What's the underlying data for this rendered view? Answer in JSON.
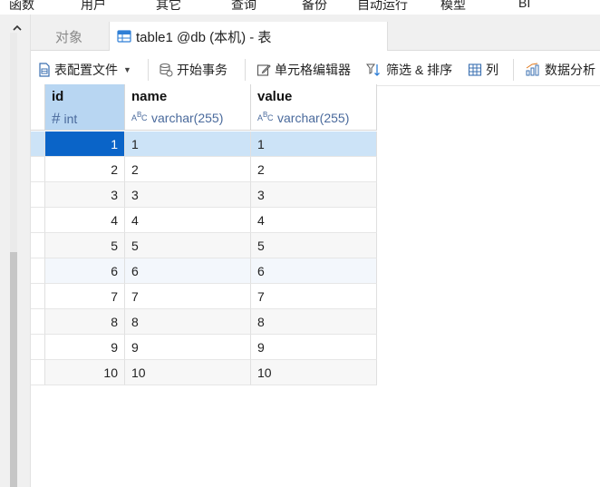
{
  "menubar": {
    "items": [
      "函数",
      "用户",
      "其它",
      "查询",
      "备份",
      "自动运行",
      "模型",
      "BI"
    ]
  },
  "tabs": {
    "objects_label": "对象",
    "table_label": "table1 @db (本机) - 表"
  },
  "toolbar": {
    "table_config_label": "表配置文件",
    "begin_transaction_label": "开始事务",
    "cell_editor_label": "单元格编辑器",
    "filter_sort_label": "筛选 & 排序",
    "columns_label": "列",
    "data_analysis_label": "数据分析"
  },
  "columns": [
    {
      "name": "id",
      "type": "int",
      "type_icon": "#"
    },
    {
      "name": "name",
      "type": "varchar(255)",
      "type_icon": "ABC"
    },
    {
      "name": "value",
      "type": "varchar(255)",
      "type_icon": "ABC"
    }
  ],
  "rows": [
    [
      "1",
      "1",
      "1"
    ],
    [
      "2",
      "2",
      "2"
    ],
    [
      "3",
      "3",
      "3"
    ],
    [
      "4",
      "4",
      "4"
    ],
    [
      "5",
      "5",
      "5"
    ],
    [
      "6",
      "6",
      "6"
    ],
    [
      "7",
      "7",
      "7"
    ],
    [
      "8",
      "8",
      "8"
    ],
    [
      "9",
      "9",
      "9"
    ],
    [
      "10",
      "10",
      "10"
    ]
  ],
  "colors": {
    "selected_row": "#cce3f7",
    "active_cell": "#0a64c8",
    "selected_header": "#b8d6f2"
  }
}
